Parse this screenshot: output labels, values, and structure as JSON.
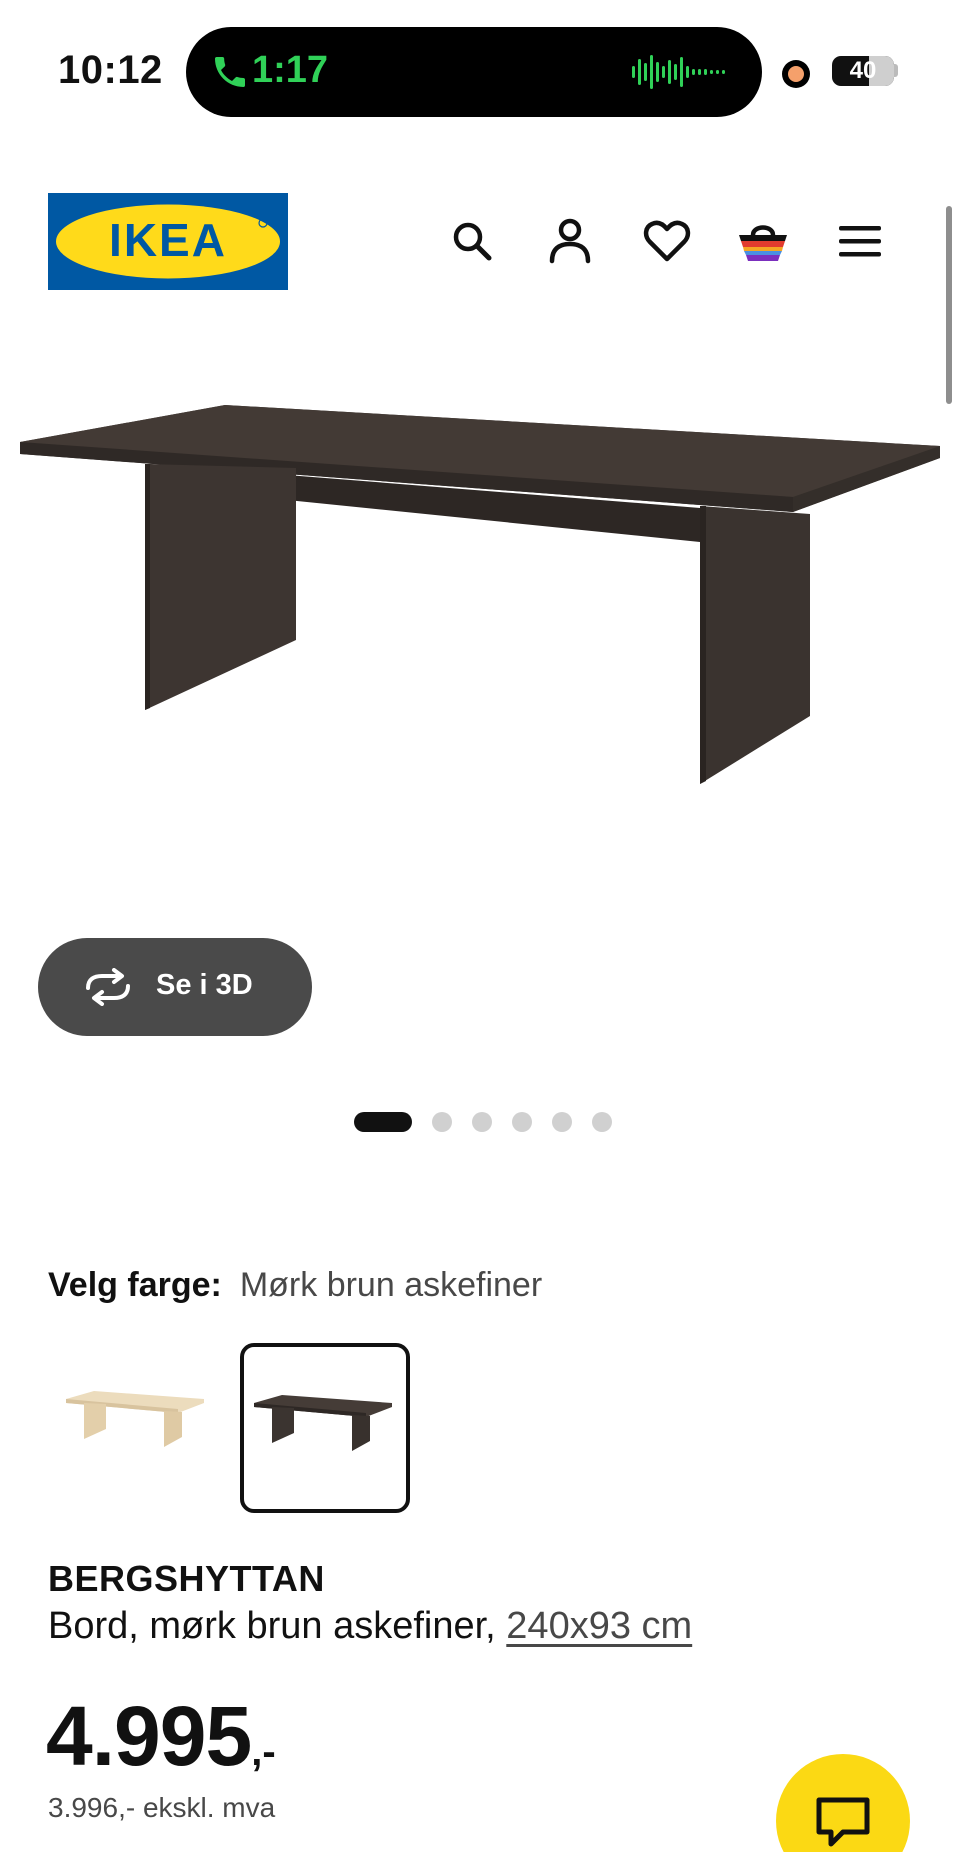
{
  "status_bar": {
    "time": "10:12",
    "call_duration": "1:17",
    "battery": "40",
    "battery_level": 0.4,
    "colors": {
      "call_green": "#30d158",
      "recording_dot": "#f5a06b"
    }
  },
  "header": {
    "logo_text": "IKEA",
    "brand_colors": {
      "blue": "#0058a3",
      "yellow": "#ffda1a"
    },
    "icons": [
      "search-icon",
      "account-icon",
      "heart-icon",
      "basket-icon",
      "menu-icon"
    ]
  },
  "gallery": {
    "view_3d_label": "Se i 3D",
    "slide_count": 6,
    "active_slide": 1
  },
  "color_selector": {
    "label": "Velg farge:",
    "value": "Mørk brun askefiner",
    "options": [
      {
        "name": "birch-veneer",
        "color": "#e8d4b2",
        "selected": false
      },
      {
        "name": "dark-brown-ash-veneer",
        "color": "#3f3834",
        "selected": true
      }
    ]
  },
  "product": {
    "name": "BERGSHYTTAN",
    "description": "Bord, mørk brun askefiner,",
    "dimensions": "240x93 cm",
    "price": "4.995",
    "price_suffix": ",-",
    "price_ex_vat": "3.996,- ekskl. mva"
  },
  "chat": {
    "color": "#fbd914"
  }
}
